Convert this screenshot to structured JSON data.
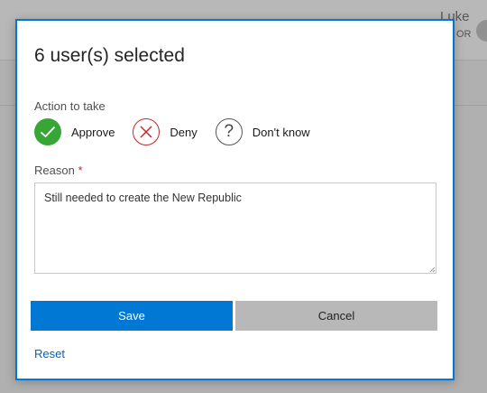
{
  "dialog": {
    "title": "6 user(s) selected",
    "action_label": "Action to take",
    "actions": [
      {
        "label": "Approve",
        "icon": "check-icon",
        "color": "#37a637"
      },
      {
        "label": "Deny",
        "icon": "x-icon",
        "color": "#c62828"
      },
      {
        "label": "Don't know",
        "icon": "question-icon",
        "color": "#555555"
      }
    ],
    "reason_label": "Reason",
    "reason_required_mark": "*",
    "reason_value": "Still needed to create the New Republic",
    "save_label": "Save",
    "cancel_label": "Cancel",
    "reset_label": "Reset",
    "accent_color": "#0078d4"
  },
  "background": {
    "user_name": "Luke",
    "user_role": "OR"
  }
}
